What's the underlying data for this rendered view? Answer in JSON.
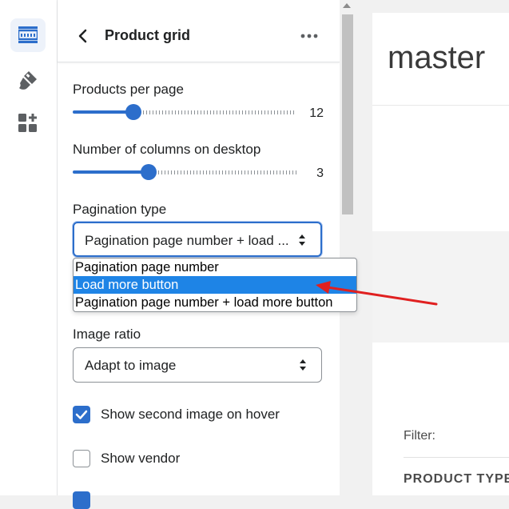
{
  "rail": {
    "items": [
      {
        "icon": "sections-icon",
        "active": true
      },
      {
        "icon": "theme-settings-icon",
        "active": false
      },
      {
        "icon": "apps-icon",
        "active": false
      }
    ]
  },
  "panel": {
    "title": "Product grid",
    "products_per_page": {
      "label": "Products per page",
      "value": "12",
      "level": 0.27
    },
    "columns_desktop": {
      "label": "Number of columns on desktop",
      "value": "3",
      "level": 0.34
    },
    "pagination": {
      "label": "Pagination type",
      "selected": "Pagination page number + load ...",
      "options": [
        "Pagination page number",
        "Load more button",
        "Pagination page number + load more button"
      ],
      "highlighted_index": 1
    },
    "image_ratio": {
      "label": "Image ratio",
      "selected": "Adapt to image"
    },
    "checkboxes": [
      {
        "label": "Show second image on hover",
        "checked": true
      },
      {
        "label": "Show vendor",
        "checked": false
      },
      {
        "label": "",
        "checked": true
      }
    ]
  },
  "preview": {
    "title": "master",
    "filter_label": "Filter:",
    "filter_heading": "PRODUCT TYPE"
  },
  "colors": {
    "accent": "#2c6ecb",
    "highlight": "#1e84e6",
    "annotation": "#e02020"
  }
}
